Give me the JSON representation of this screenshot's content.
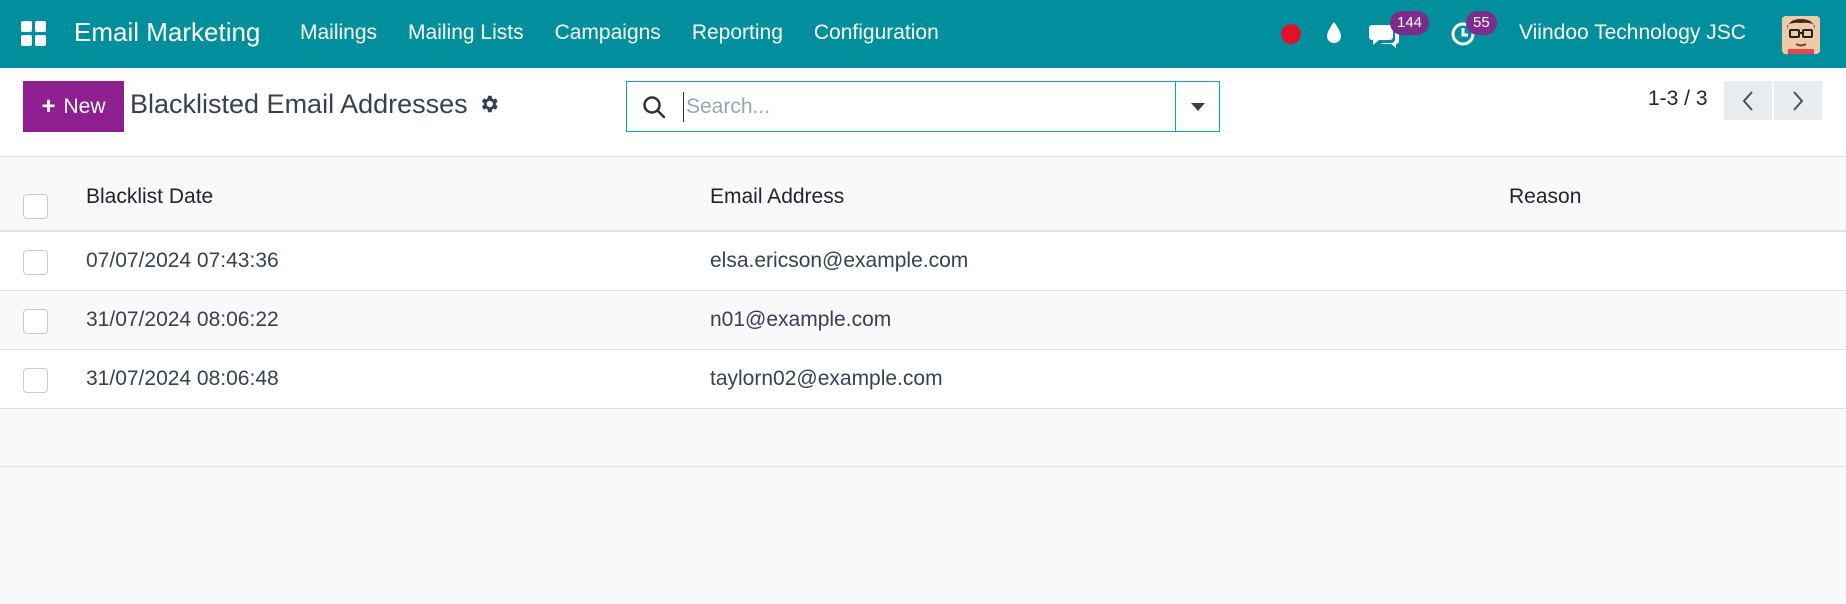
{
  "navbar": {
    "app_name": "Email Marketing",
    "menu": [
      "Mailings",
      "Mailing Lists",
      "Campaigns",
      "Reporting",
      "Configuration"
    ],
    "messages_count": "144",
    "activities_count": "55",
    "company": "Viindoo Technology JSC",
    "brand_color": "#018f9d"
  },
  "control_panel": {
    "new_label": "New",
    "title": "Blacklisted Email Addresses",
    "search_placeholder": "Search...",
    "pager": "1-3 / 3",
    "primary_color": "#8f1f8e"
  },
  "table": {
    "columns": [
      "Blacklist Date",
      "Email Address",
      "Reason"
    ],
    "rows": [
      {
        "date": "07/07/2024 07:43:36",
        "email": "elsa.ericson@example.com",
        "reason": ""
      },
      {
        "date": "31/07/2024 08:06:22",
        "email": "n01@example.com",
        "reason": ""
      },
      {
        "date": "31/07/2024 08:06:48",
        "email": "taylorn02@example.com",
        "reason": ""
      }
    ]
  }
}
